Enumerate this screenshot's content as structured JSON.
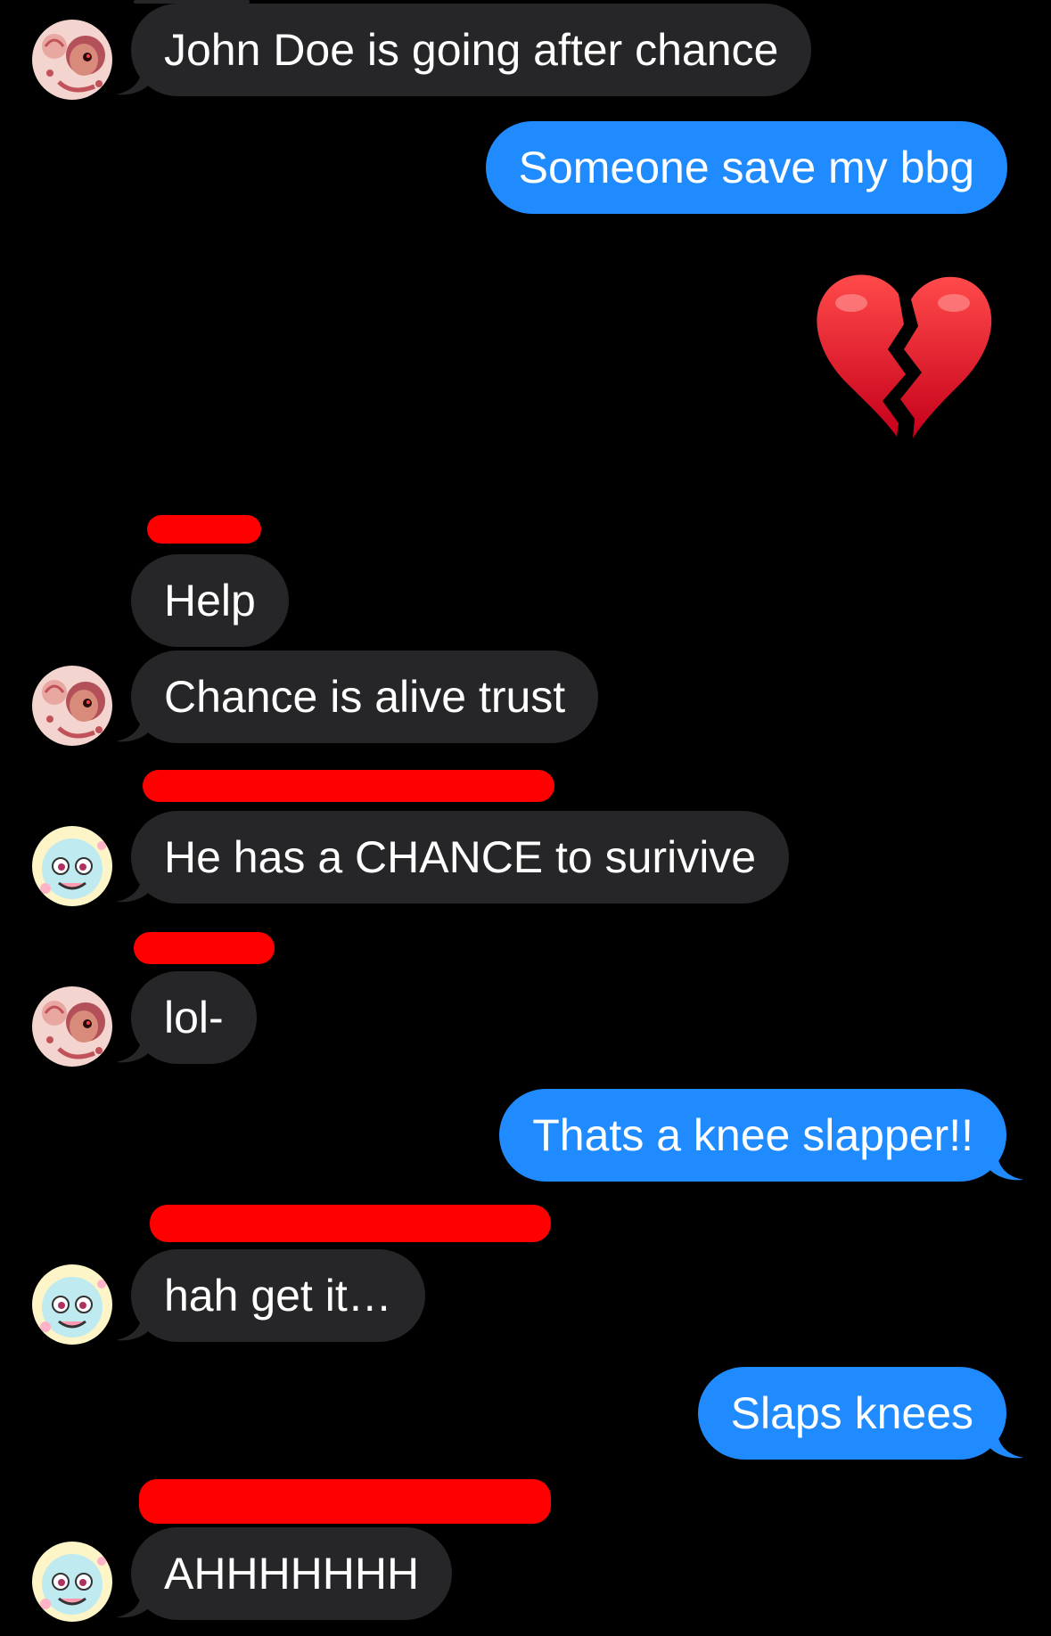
{
  "messages": [
    {
      "text": "John Doe is going after chance",
      "direction": "incoming",
      "sender_avatar": "red-character-avatar"
    },
    {
      "text": "Someone save my bbg",
      "direction": "outgoing"
    },
    {
      "emoji": "broken-heart-icon",
      "direction": "outgoing"
    },
    {
      "text": "Help",
      "direction": "incoming"
    },
    {
      "text": "Chance is alive trust",
      "direction": "incoming",
      "sender_avatar": "red-character-avatar"
    },
    {
      "text": "He has a CHANCE to surivive",
      "direction": "incoming",
      "sender_avatar": "blue-character-avatar"
    },
    {
      "text": "lol-",
      "direction": "incoming",
      "sender_avatar": "red-character-avatar"
    },
    {
      "text": "Thats a knee slapper!!",
      "direction": "outgoing"
    },
    {
      "text": "hah get it…",
      "direction": "incoming",
      "sender_avatar": "blue-character-avatar"
    },
    {
      "text": "Slaps knees",
      "direction": "outgoing"
    },
    {
      "text": "AHHHHHHH",
      "direction": "incoming",
      "sender_avatar": "blue-character-avatar"
    }
  ],
  "colors": {
    "background": "#000000",
    "incoming_bubble": "#262628",
    "outgoing_bubble": "#1f8bff",
    "redaction": "#ff0000"
  }
}
